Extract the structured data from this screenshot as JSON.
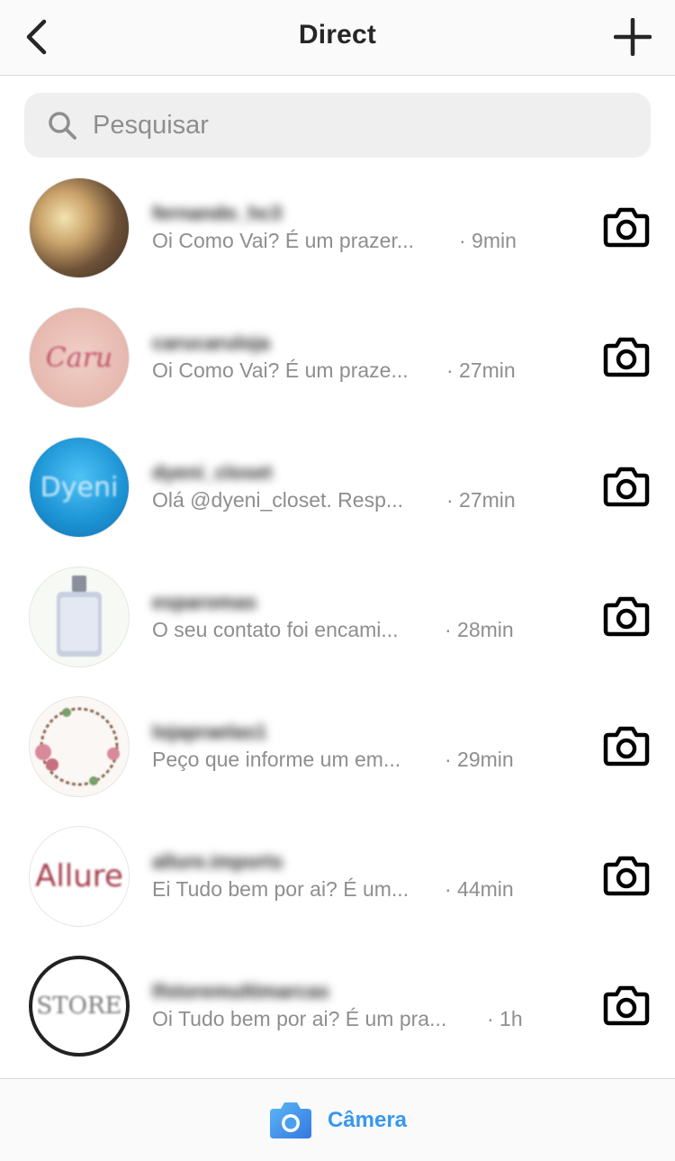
{
  "header": {
    "title": "Direct",
    "back_icon": "chevron-left-icon",
    "new_icon": "plus-icon"
  },
  "search": {
    "placeholder": "Pesquisar",
    "icon": "search-icon"
  },
  "threads": [
    {
      "username": "fernando_hc3",
      "preview": "Oi Como Vai? É um prazer...",
      "time": "· 9min"
    },
    {
      "username": "carucaruloja",
      "preview": "Oi Como Vai? É um praze...",
      "time": "· 27min"
    },
    {
      "username": "dyeni_closet",
      "preview": "Olá @dyeni_closet. Resp...",
      "time": "· 27min"
    },
    {
      "username": "esparomas",
      "preview": "O seu contato foi encami...",
      "time": "· 28min"
    },
    {
      "username": "lojapraelas1",
      "preview": "Peço que informe um em...",
      "time": "· 29min"
    },
    {
      "username": "allure.imports",
      "preview": "Ei Tudo bem por ai? É um...",
      "time": "· 44min"
    },
    {
      "username": "lfstoremultimarcas",
      "preview": "Oi Tudo bem por ai? É um pra...",
      "time": "· 1h"
    }
  ],
  "footer": {
    "camera_label": "Câmera",
    "accent": "#3897f0"
  },
  "colors": {
    "primary_text": "#262626",
    "secondary_text": "#8e8e8e",
    "search_bg": "#efefef"
  }
}
